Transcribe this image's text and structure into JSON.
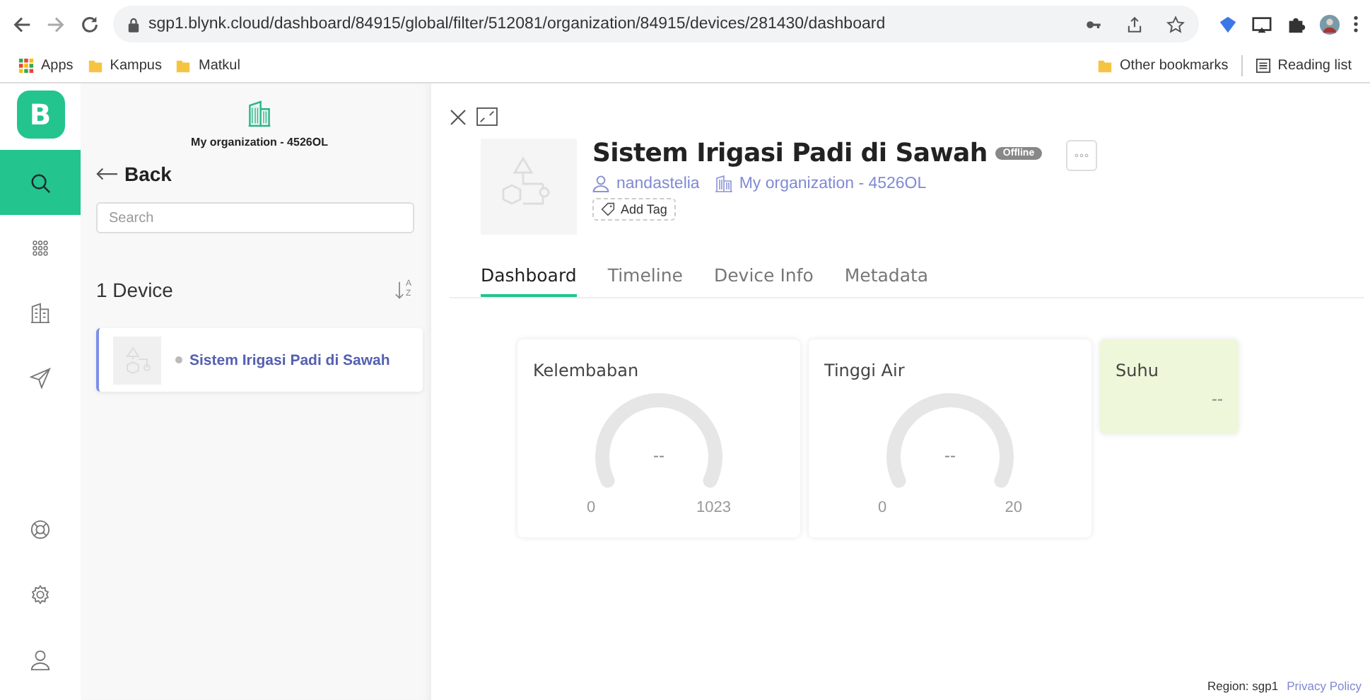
{
  "browser": {
    "url": "sgp1.blynk.cloud/dashboard/84915/global/filter/512081/organization/84915/devices/281430/dashboard",
    "bookmarks": [
      {
        "label": "Apps",
        "kind": "apps"
      },
      {
        "label": "Kampus",
        "kind": "folder"
      },
      {
        "label": "Matkul",
        "kind": "folder"
      }
    ],
    "bookmarks_right": [
      {
        "label": "Other bookmarks",
        "kind": "folder"
      },
      {
        "label": "Reading list",
        "kind": "reading"
      }
    ]
  },
  "logo": "B",
  "rail": [
    {
      "kind": "search",
      "selected": true
    },
    {
      "kind": "apps",
      "selected": false
    },
    {
      "kind": "building",
      "selected": false
    },
    {
      "kind": "send",
      "selected": false
    }
  ],
  "rail_bottom": [
    {
      "kind": "help"
    },
    {
      "kind": "settings"
    },
    {
      "kind": "user"
    }
  ],
  "panel": {
    "organization": "My organization - 4526OL",
    "back": "Back",
    "search": {
      "placeholder": "Search"
    },
    "count": "1 Device",
    "sort": {
      "from": "A",
      "to": "Z"
    },
    "devices": [
      {
        "name": "Sistem Irigasi Padi di Sawah",
        "selected": true,
        "online": false
      }
    ]
  },
  "device": {
    "name": "Sistem Irigasi Padi di Sawah",
    "status": "Offline",
    "owner": "nandastelia",
    "organization": "My organization - 4526OL",
    "add_tag": "Add Tag"
  },
  "tabs": [
    {
      "label": "Dashboard",
      "selected": true
    },
    {
      "label": "Timeline",
      "selected": false
    },
    {
      "label": "Device Info",
      "selected": false
    },
    {
      "label": "Metadata",
      "selected": false
    }
  ],
  "widgets": [
    {
      "kind": "gauge",
      "title": "Kelembaban",
      "value": "--",
      "min": "0",
      "max": "1023"
    },
    {
      "kind": "gauge",
      "title": "Tinggi Air",
      "value": "--",
      "min": "0",
      "max": "20"
    },
    {
      "kind": "label",
      "title": "Suhu",
      "value": "--"
    }
  ],
  "footer": {
    "region": "Region: sgp1",
    "privacy": "Privacy Policy"
  }
}
